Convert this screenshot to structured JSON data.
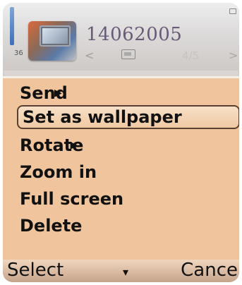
{
  "header": {
    "signal_label": "36",
    "title": "14062005",
    "page_counter": "4/5",
    "chevron_left": "<",
    "chevron_right": ">"
  },
  "menu": {
    "items": [
      {
        "label": "Send",
        "has_submenu": true
      },
      {
        "label": "Set as wallpaper",
        "selected": true
      },
      {
        "label": "Rotate",
        "has_submenu": true
      },
      {
        "label": "Zoom in"
      },
      {
        "label": "Full screen"
      },
      {
        "label": "Delete"
      }
    ]
  },
  "softkeys": {
    "left": "Select",
    "middle": "▾",
    "right": "Cance"
  },
  "colors": {
    "menu_bg": "#f0c49c",
    "selected_border": "#5a4030",
    "title": "#6a5a78"
  },
  "icons": {
    "thumbnail": "gallery-thumbnail-icon",
    "image": "image-icon",
    "submenu_arrow": "chevron-right-icon"
  }
}
